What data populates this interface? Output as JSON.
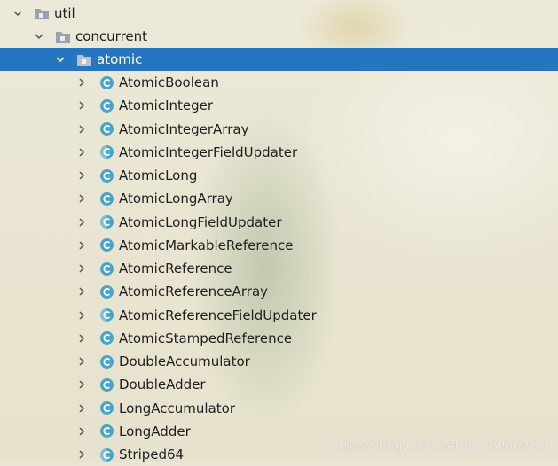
{
  "tree": {
    "root": {
      "label": "util",
      "icon": "package-folder-icon",
      "expanded": true
    },
    "level1": {
      "label": "concurrent",
      "icon": "package-folder-icon",
      "expanded": true
    },
    "level2": {
      "label": "atomic",
      "icon": "package-folder-icon",
      "expanded": true,
      "selected": true
    },
    "classes": [
      {
        "label": "AtomicBoolean",
        "icon": "class-icon"
      },
      {
        "label": "AtomicInteger",
        "icon": "class-icon"
      },
      {
        "label": "AtomicIntegerArray",
        "icon": "class-icon"
      },
      {
        "label": "AtomicIntegerFieldUpdater",
        "icon": "abstract-class-icon"
      },
      {
        "label": "AtomicLong",
        "icon": "class-icon"
      },
      {
        "label": "AtomicLongArray",
        "icon": "class-icon"
      },
      {
        "label": "AtomicLongFieldUpdater",
        "icon": "abstract-class-icon"
      },
      {
        "label": "AtomicMarkableReference",
        "icon": "class-icon"
      },
      {
        "label": "AtomicReference",
        "icon": "class-icon"
      },
      {
        "label": "AtomicReferenceArray",
        "icon": "class-icon"
      },
      {
        "label": "AtomicReferenceFieldUpdater",
        "icon": "abstract-class-icon"
      },
      {
        "label": "AtomicStampedReference",
        "icon": "class-icon"
      },
      {
        "label": "DoubleAccumulator",
        "icon": "class-icon"
      },
      {
        "label": "DoubleAdder",
        "icon": "class-icon"
      },
      {
        "label": "LongAccumulator",
        "icon": "class-icon"
      },
      {
        "label": "LongAdder",
        "icon": "class-icon"
      },
      {
        "label": "Striped64",
        "icon": "abstract-class-icon"
      }
    ]
  },
  "colors": {
    "selection": "#2675bf",
    "class_icon": "#4aa3c8",
    "folder": "#9aa3ad"
  },
  "watermark": "https://blog.csdn.net/qq_39504520"
}
